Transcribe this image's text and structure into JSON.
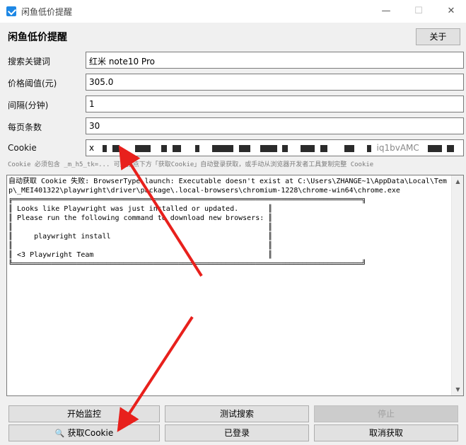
{
  "window": {
    "title": "闲鱼低价提醒",
    "min_glyph": "—",
    "max_glyph": "☐",
    "close_glyph": "✕"
  },
  "header": {
    "title": "闲鱼低价提醒",
    "about_label": "关于"
  },
  "form": {
    "keyword": {
      "label": "搜索关键词",
      "value": "红米 note10 Pro"
    },
    "price": {
      "label": "价格阈值(元)",
      "value": "305.0"
    },
    "interval": {
      "label": "间隔(分钟)",
      "value": "1"
    },
    "page_size": {
      "label": "每页条数",
      "value": "30"
    },
    "cookie": {
      "label": "Cookie",
      "value_prefix": "x",
      "value_fragment": "iq1bvAMC"
    }
  },
  "hint": "Cookie 必须包含 _m_h5_tk=... 可直接点下方「获取Cookie」自动登录获取，或手动从浏览器开发者工具复制完整 Cookie",
  "log": {
    "text": "自动获取 Cookie 失败: BrowserType.launch: Executable doesn't exist at C:\\Users\\ZHANGE~1\\AppData\\Local\\Temp\\_MEI401322\\playwright\\driver\\package\\.local-browsers\\chromium-1228\\chrome-win64\\chrome.exe\n╔══════════════════════════════════════════════════════════════════════════════════╗\n║ Looks like Playwright was just installed or updated.       ║\n║ Please run the following command to download new browsers: ║\n║                                                            ║\n║     playwright install                                     ║\n║                                                            ║\n║ <3 Playwright Team                                         ║\n╚══════════════════════════════════════════════════════════════════════════════════╝",
    "scroll_up_glyph": "▲",
    "scroll_down_glyph": "▼"
  },
  "buttons": {
    "start": "开始监控",
    "test": "测试搜索",
    "stop": "停止",
    "get_cookie": "获取Cookie",
    "logged_in": "已登录",
    "cancel_get": "取消获取"
  },
  "icons": {
    "get_cookie": "search-icon",
    "app": "app-logo-icon"
  },
  "colors": {
    "annotation_arrow": "#e8201c"
  }
}
